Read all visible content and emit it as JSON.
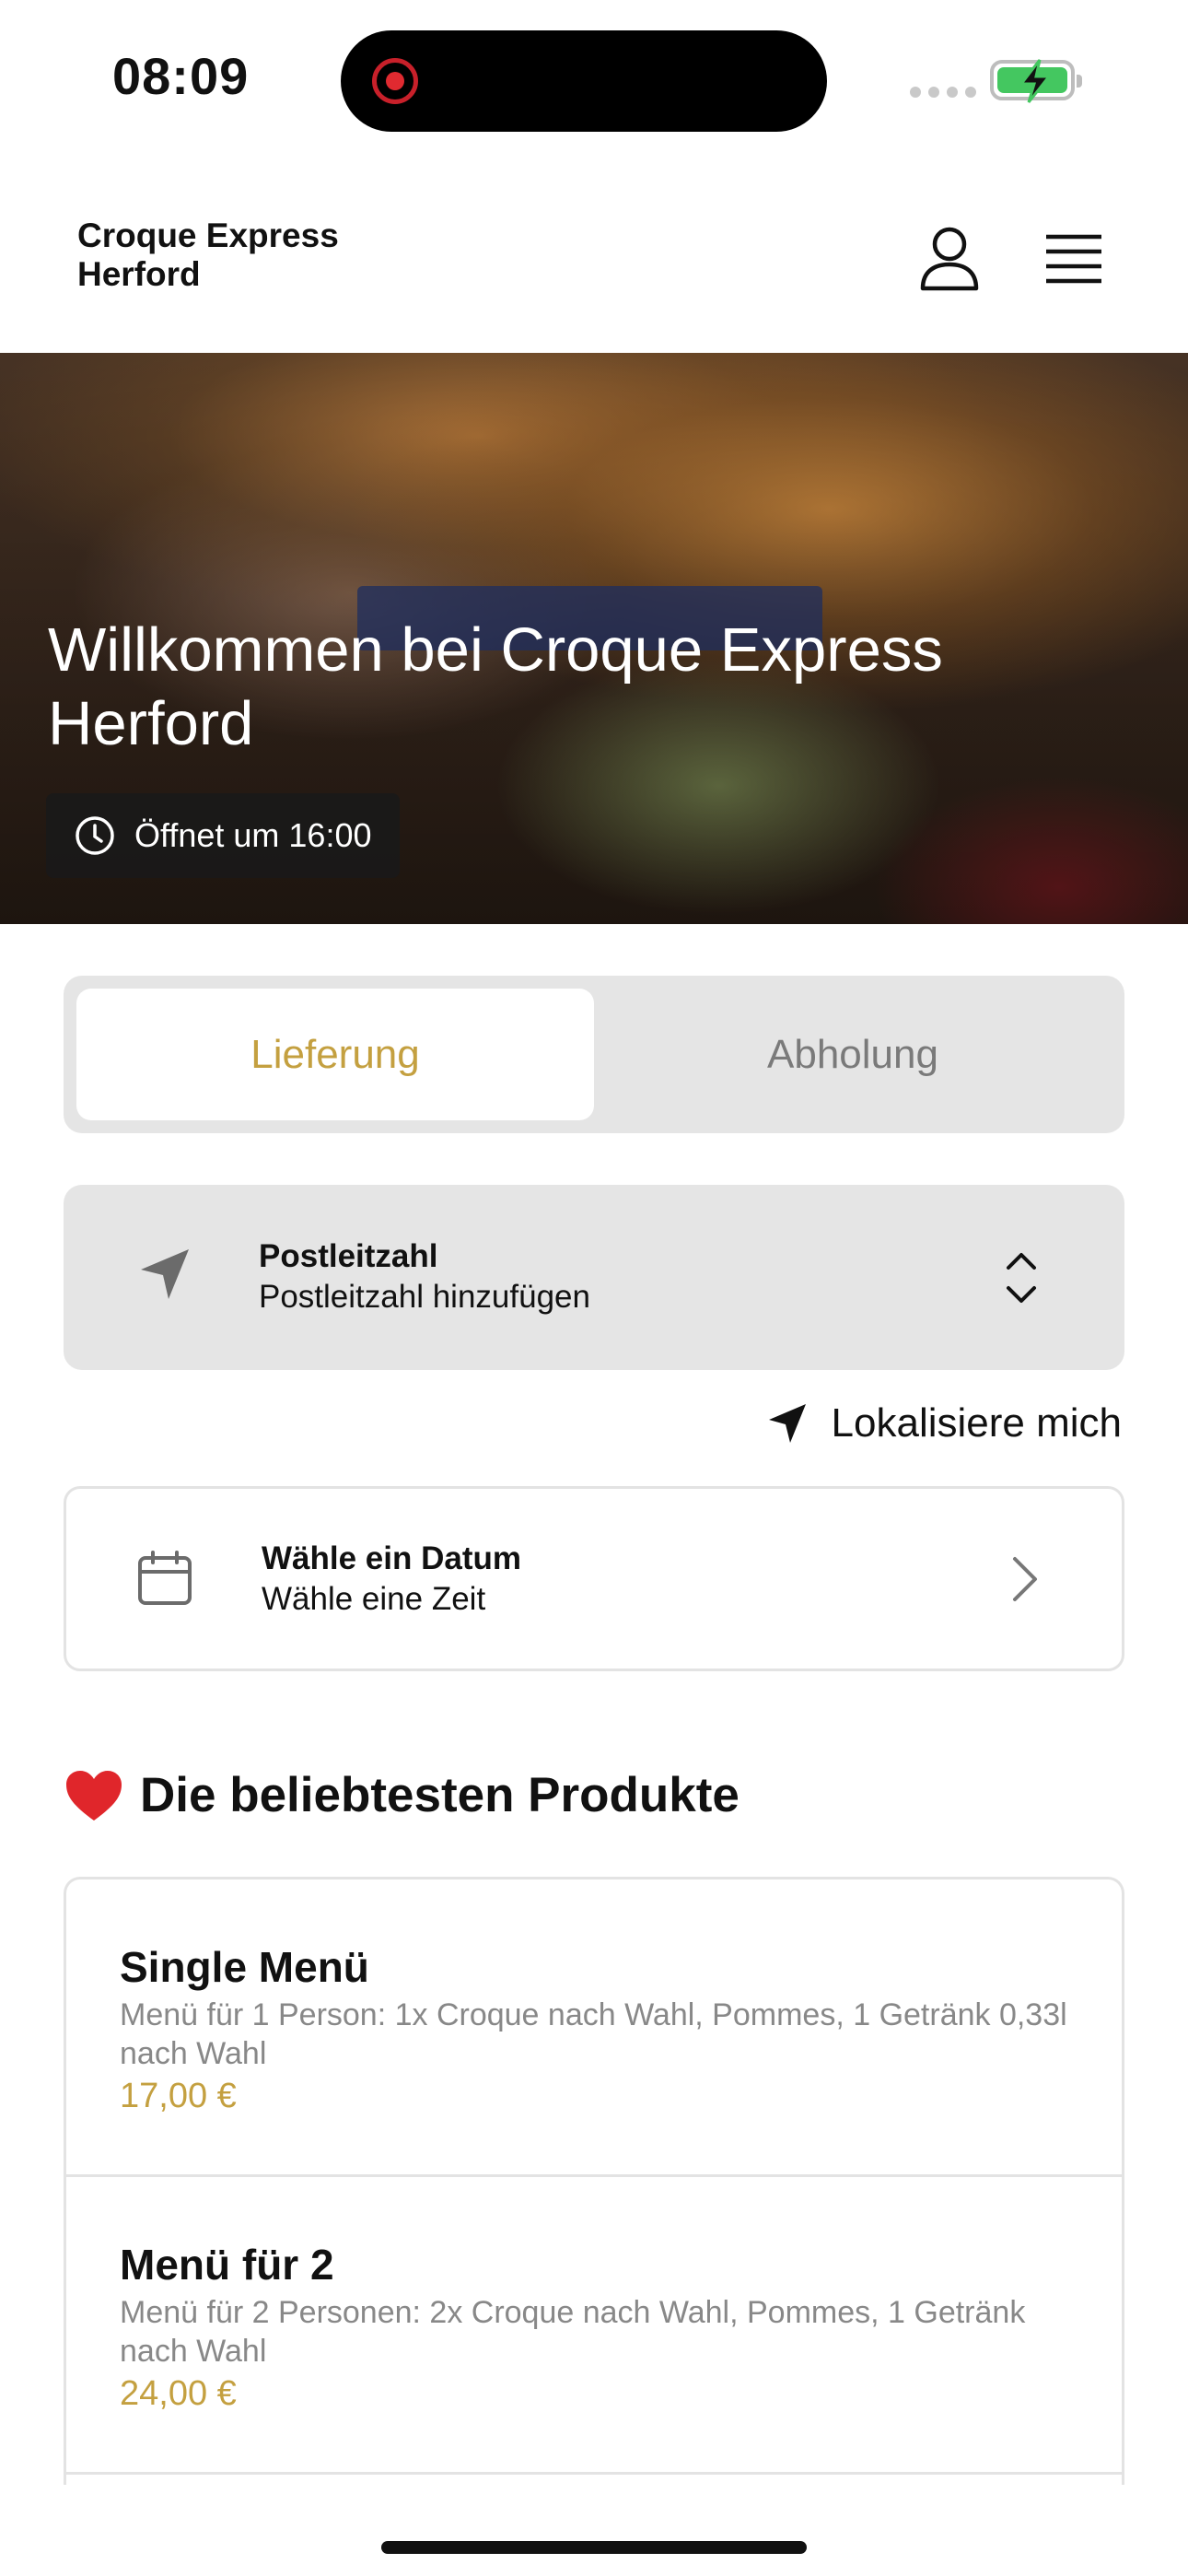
{
  "status_bar": {
    "time": "08:09",
    "accent_recording": "#e02a30",
    "battery_color": "#44c760"
  },
  "header": {
    "brand": "Croque Express Herford",
    "icons": [
      "user-icon",
      "hamburger-menu-icon"
    ]
  },
  "hero": {
    "title": "Willkommen bei Croque Express Herford",
    "open_status": "Öffnet um 16:00",
    "icon": "clock-icon"
  },
  "order_mode": {
    "options": [
      "Lieferung",
      "Abholung"
    ],
    "selected": "Lieferung",
    "accent": "#c4a040"
  },
  "postcode": {
    "label": "Postleitzahl",
    "value": "Postleitzahl hinzufügen",
    "icon": "location-arrow-icon"
  },
  "locate_me": {
    "label": "Lokalisiere mich",
    "icon": "location-arrow-icon"
  },
  "date_picker": {
    "label": "Wähle ein Datum",
    "value": "Wähle eine Zeit",
    "icon": "calendar-icon"
  },
  "popular": {
    "title_emoji": "❤️",
    "title": "Die beliebtesten Produkte",
    "products": [
      {
        "name": "Single Menü",
        "description": "Menü für 1 Person: 1x Croque nach Wahl, Pommes, 1 Getränk 0,33l nach Wahl",
        "price": "17,00 €"
      },
      {
        "name": "Menü für 2",
        "description": "Menü für 2 Personen: 2x Croque nach Wahl, Pommes, 1 Getränk nach Wahl",
        "price": "24,00 €"
      }
    ]
  }
}
